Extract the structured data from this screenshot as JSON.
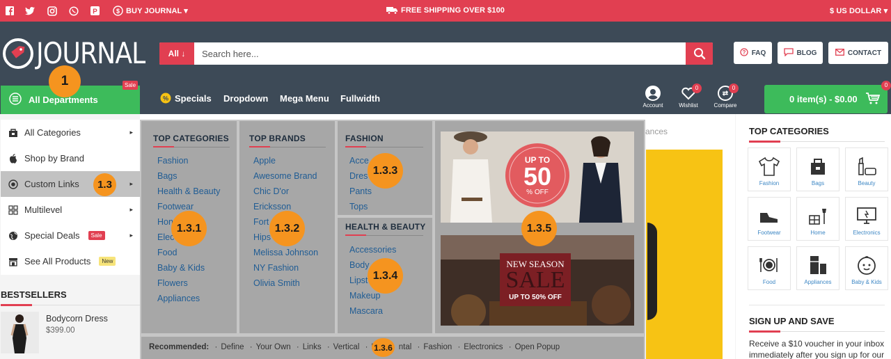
{
  "topbar": {
    "buy_journal": "BUY JOURNAL",
    "shipping": "FREE SHIPPING OVER $100",
    "currency": "$ US DOLLAR"
  },
  "header": {
    "logo": "JOURNAL",
    "search_category": "All",
    "search_placeholder": "Search here...",
    "faq": "FAQ",
    "blog": "BLOG",
    "contact": "CONTACT"
  },
  "nav": {
    "all_departments": "All Departments",
    "sale_badge": "Sale",
    "items": [
      "Specials",
      "Dropdown",
      "Mega Menu",
      "Fullwidth"
    ],
    "account": "Account",
    "wishlist": "Wishlist",
    "wishlist_count": "0",
    "compare": "Compare",
    "compare_count": "0",
    "cart": "0 item(s) - $0.00",
    "cart_count": "0"
  },
  "left_menu": {
    "items": [
      {
        "label": "All Categories"
      },
      {
        "label": "Shop by Brand"
      },
      {
        "label": "Custom Links"
      },
      {
        "label": "Multilevel"
      },
      {
        "label": "Special Deals",
        "badge": "Sale"
      },
      {
        "label": "See All Products",
        "badge": "New"
      }
    ]
  },
  "bestsellers": {
    "title": "BESTSELLERS",
    "product_name": "Bodycorn Dress",
    "product_price": "$399.00"
  },
  "mega_menu": {
    "top_categories": {
      "title": "TOP CATEGORIES",
      "links": [
        "Fashion",
        "Bags",
        "Health & Beauty",
        "Footwear",
        "Hon",
        "Elec",
        "Food",
        "Baby & Kids",
        "Flowers",
        "Appliances"
      ]
    },
    "top_brands": {
      "title": "TOP BRANDS",
      "links": [
        "Apple",
        "Awesome Brand",
        "Chic D'or",
        "Ericksson",
        "Fort",
        "Hips",
        "Melissa Johnson",
        "NY Fashion",
        "Olivia Smith"
      ]
    },
    "fashion": {
      "title": "FASHION",
      "links": [
        "Acce",
        "Dres",
        "Pants",
        "Tops"
      ]
    },
    "health_beauty": {
      "title": "HEALTH & BEAUTY",
      "links": [
        "Accessories",
        "Body",
        "Lipst",
        "Makeup",
        "Mascara"
      ]
    },
    "banner1": {
      "line1": "UP TO",
      "big": "50",
      "line3": "% OFF"
    },
    "banner2": {
      "line1": "NEW SEASON",
      "big": "SALE",
      "line3": "UP TO 50% OFF"
    },
    "recommended_label": "Recommended:",
    "recommended": [
      "Define",
      "Your Own",
      "Links",
      "Vertical",
      "H",
      "ntal",
      "Fashion",
      "Electronics",
      "Open Popup"
    ]
  },
  "content": {
    "partial_text": "ances"
  },
  "right_column": {
    "title": "TOP CATEGORIES",
    "tiles": [
      "Fashion",
      "Bags",
      "Beauty",
      "Footwear",
      "Home",
      "Electronics",
      "Food",
      "Appliances",
      "Baby & Kids"
    ],
    "signup_title": "SIGN UP AND SAVE",
    "signup_line1": "Receive a $10 voucher in your inbox",
    "signup_line2": "immediately after you sign up for our"
  },
  "annotations": [
    "1",
    "1.3",
    "1.3.1",
    "1.3.2",
    "1.3.3",
    "1.3.4",
    "1.3.5",
    "1.3.6"
  ],
  "colors": {
    "brand_red": "#e13f51",
    "header_dark": "#3d4a57",
    "green": "#3dbb5b",
    "annotation_orange": "#f5941f",
    "link_blue": "#1f5c94"
  }
}
